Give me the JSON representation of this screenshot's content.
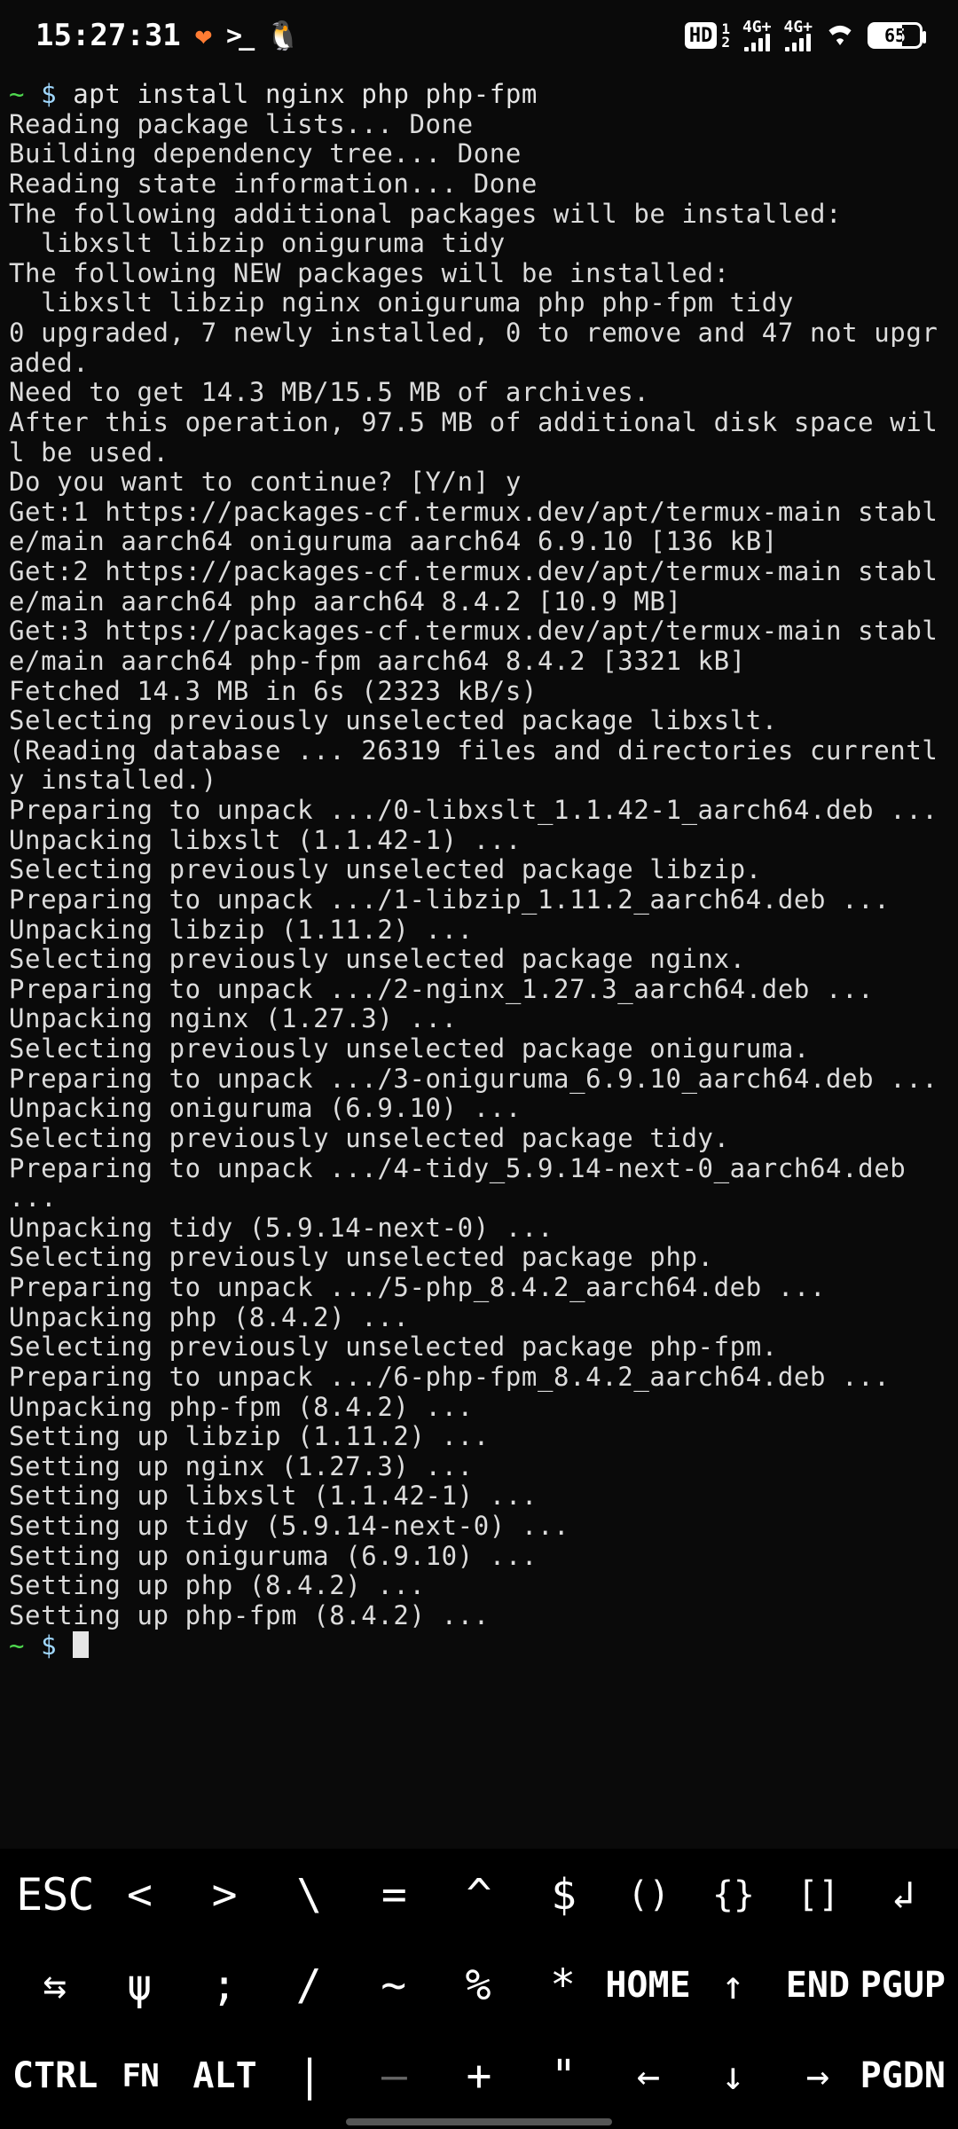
{
  "status": {
    "time": "15:27:31",
    "hd_label": "HD",
    "hd_sub1": "1",
    "hd_sub2": "2",
    "sig1_label": "4G+",
    "sig2_label": "4G+",
    "battery_pct": "65"
  },
  "terminal": {
    "prompt_tilde": "~",
    "prompt_dollar": " $ ",
    "cmd1": "apt install nginx php php-fpm",
    "lines": [
      "Reading package lists... Done",
      "Building dependency tree... Done",
      "Reading state information... Done",
      "The following additional packages will be installed:",
      "  libxslt libzip oniguruma tidy",
      "The following NEW packages will be installed:",
      "  libxslt libzip nginx oniguruma php php-fpm tidy",
      "0 upgraded, 7 newly installed, 0 to remove and 47 not upgraded.",
      "Need to get 14.3 MB/15.5 MB of archives.",
      "After this operation, 97.5 MB of additional disk space will be used.",
      "Do you want to continue? [Y/n] y",
      "Get:1 https://packages-cf.termux.dev/apt/termux-main stable/main aarch64 oniguruma aarch64 6.9.10 [136 kB]",
      "Get:2 https://packages-cf.termux.dev/apt/termux-main stable/main aarch64 php aarch64 8.4.2 [10.9 MB]",
      "Get:3 https://packages-cf.termux.dev/apt/termux-main stable/main aarch64 php-fpm aarch64 8.4.2 [3321 kB]",
      "Fetched 14.3 MB in 6s (2323 kB/s)",
      "Selecting previously unselected package libxslt.",
      "(Reading database ... 26319 files and directories currently installed.)",
      "Preparing to unpack .../0-libxslt_1.1.42-1_aarch64.deb ...",
      "Unpacking libxslt (1.1.42-1) ...",
      "Selecting previously unselected package libzip.",
      "Preparing to unpack .../1-libzip_1.11.2_aarch64.deb ...",
      "Unpacking libzip (1.11.2) ...",
      "Selecting previously unselected package nginx.",
      "Preparing to unpack .../2-nginx_1.27.3_aarch64.deb ...",
      "Unpacking nginx (1.27.3) ...",
      "Selecting previously unselected package oniguruma.",
      "Preparing to unpack .../3-oniguruma_6.9.10_aarch64.deb ...",
      "Unpacking oniguruma (6.9.10) ...",
      "Selecting previously unselected package tidy.",
      "Preparing to unpack .../4-tidy_5.9.14-next-0_aarch64.deb ...",
      "Unpacking tidy (5.9.14-next-0) ...",
      "Selecting previously unselected package php.",
      "Preparing to unpack .../5-php_8.4.2_aarch64.deb ...",
      "Unpacking php (8.4.2) ...",
      "Selecting previously unselected package php-fpm.",
      "Preparing to unpack .../6-php-fpm_8.4.2_aarch64.deb ...",
      "Unpacking php-fpm (8.4.2) ...",
      "Setting up libzip (1.11.2) ...",
      "Setting up nginx (1.27.3) ...",
      "Setting up libxslt (1.1.42-1) ...",
      "Setting up tidy (5.9.14-next-0) ...",
      "Setting up oniguruma (6.9.10) ...",
      "Setting up php (8.4.2) ...",
      "Setting up php-fpm (8.4.2) ..."
    ]
  },
  "keys": {
    "row1": [
      "ESC",
      "<",
      ">",
      "\\",
      "=",
      "^",
      "$",
      "()",
      "{}",
      "[]",
      "↲"
    ],
    "row2": [
      "⇆",
      "ψ",
      ";",
      "/",
      "~",
      "%",
      "*",
      "HO\nME",
      "↑",
      "EN\nD",
      "PG\nUP"
    ],
    "row3": [
      "CT\nRL",
      "FN",
      "AL\nT",
      "|",
      "—",
      "+",
      "\"",
      "←",
      "↓",
      "→",
      "PG\nDN"
    ]
  }
}
